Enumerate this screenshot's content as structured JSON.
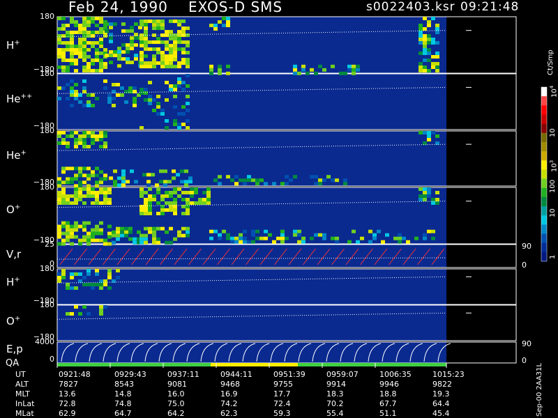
{
  "header": {
    "date": "Feb 24, 1990",
    "instrument": "EXOS-D SMS",
    "file": "s0022403.ksr",
    "time": "09:21:48"
  },
  "colorbar": {
    "unit": "Ct/Smp",
    "ticks": [
      "10",
      "10",
      "10",
      "100",
      "10",
      "1"
    ],
    "tick_exponents": [
      "4",
      "",
      "3",
      "",
      "",
      ""
    ],
    "colors": [
      "#ffffff",
      "#ff4444",
      "#ff0000",
      "#cc0000",
      "#8b0000",
      "#7a6a00",
      "#a08a00",
      "#ccaa00",
      "#ffee00",
      "#c8e000",
      "#70d020",
      "#20b020",
      "#008a40",
      "#00a0a0",
      "#00c8e0",
      "#0088c8",
      "#0050b0",
      "#002c98",
      "#001880"
    ]
  },
  "panels": [
    {
      "label": "H",
      "sup": "+",
      "top": "180",
      "bottom": "−180"
    },
    {
      "label": "He",
      "sup": "++",
      "top": "180",
      "bottom": "−180"
    },
    {
      "label": "He",
      "sup": "+",
      "top": "180",
      "bottom": "−180"
    },
    {
      "label": "O",
      "sup": "+",
      "top": "180",
      "bottom": "−180"
    },
    {
      "label": "V,r",
      "sup": "",
      "top": "25",
      "bottom": "0",
      "right_top": "90",
      "right_bottom": "0"
    },
    {
      "label": "H",
      "sup": "+",
      "top": "180",
      "bottom": "−180"
    },
    {
      "label": "O",
      "sup": "+",
      "top": "180",
      "bottom": "−180"
    },
    {
      "label": "E,p",
      "sup": "",
      "top": "4000",
      "bottom": "0",
      "right_top": "90",
      "right_bottom": "0"
    }
  ],
  "qa_label": "QA",
  "footer_id": "Sep-00  2AA31L",
  "table": {
    "rows": [
      {
        "label": "UT",
        "values": [
          "0921:48",
          "0929:43",
          "0937:11",
          "0944:11",
          "0951:39",
          "0959:07",
          "1006:35",
          "1015:23"
        ]
      },
      {
        "label": "ALT",
        "values": [
          "7827",
          "8543",
          "9081",
          "9468",
          "9755",
          "9914",
          "9946",
          "9822"
        ]
      },
      {
        "label": "MLT",
        "values": [
          "13.6",
          "14.8",
          "16.0",
          "16.9",
          "17.7",
          "18.3",
          "18.8",
          "19.3"
        ]
      },
      {
        "label": "InLat",
        "values": [
          "72.8",
          "74.8",
          "75.0",
          "74.2",
          "72.4",
          "70.2",
          "67.7",
          "64.4"
        ]
      },
      {
        "label": "MLat",
        "values": [
          "62.9",
          "64.7",
          "64.2",
          "62.3",
          "59.3",
          "55.4",
          "51.1",
          "45.4"
        ]
      }
    ]
  },
  "chart_data": {
    "type": "heatmap",
    "title": "Feb 24, 1990   EXOS-D SMS",
    "x_ticks": [
      "0921:48",
      "0929:43",
      "0937:11",
      "0944:11",
      "0951:39",
      "0959:07",
      "1006:35",
      "1015:23"
    ],
    "panels": [
      "H+",
      "He++",
      "He+",
      "O+",
      "V,r",
      "H+",
      "O+",
      "E,p"
    ],
    "y_ranges": [
      [
        -180,
        180
      ],
      [
        -180,
        180
      ],
      [
        -180,
        180
      ],
      [
        -180,
        180
      ],
      [
        0,
        25
      ],
      [
        -180,
        180
      ],
      [
        -180,
        180
      ],
      [
        0,
        4000
      ]
    ],
    "colorbar_range": [
      1,
      10000
    ],
    "colorbar_scale": "log"
  }
}
